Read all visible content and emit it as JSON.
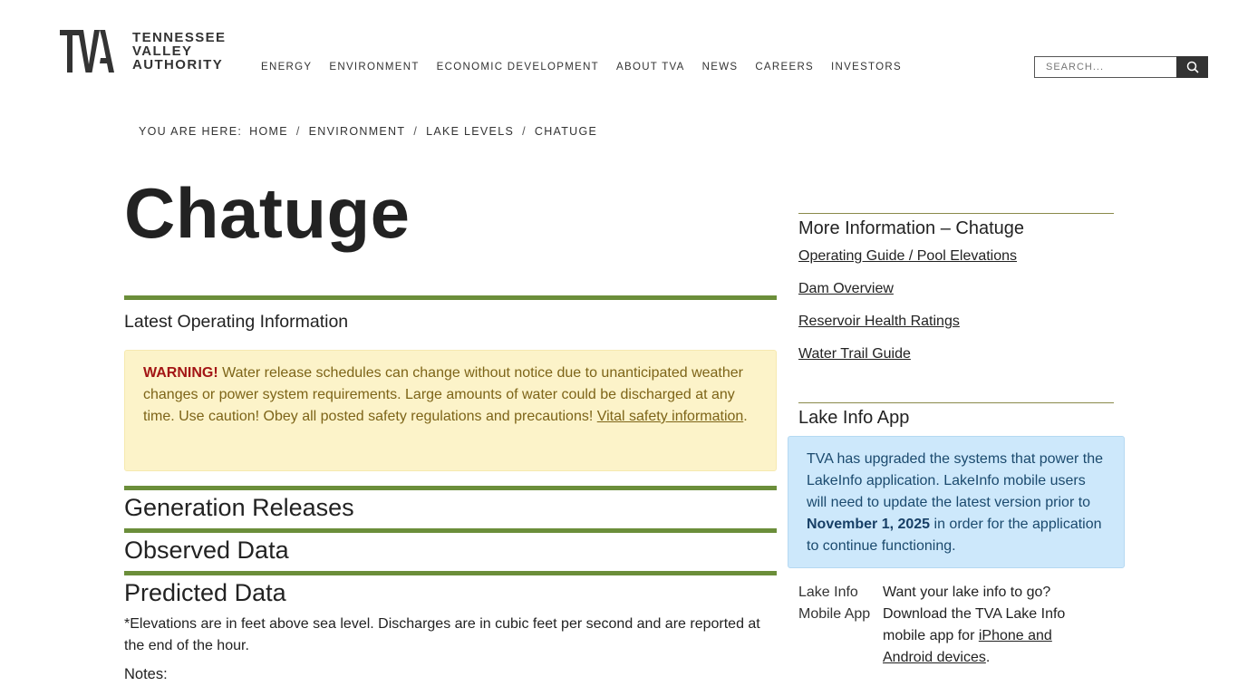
{
  "header": {
    "logo_lines": [
      "TENNESSEE",
      "VALLEY",
      "AUTHORITY"
    ],
    "nav": [
      "ENERGY",
      "ENVIRONMENT",
      "ECONOMIC DEVELOPMENT",
      "ABOUT TVA",
      "NEWS",
      "CAREERS",
      "INVESTORS"
    ],
    "search_placeholder": "SEARCH..."
  },
  "breadcrumb": {
    "lead": "YOU ARE HERE:",
    "items": [
      "HOME",
      "ENVIRONMENT",
      "LAKE LEVELS",
      "CHATUGE"
    ]
  },
  "main": {
    "title": "Chatuge",
    "latest_heading": "Latest Operating Information",
    "warning_label": "WARNING!",
    "warning_text": " Water release schedules can change without notice due to unanticipated weather changes or power system requirements. Large amounts of water could be discharged at any time. Use caution! Obey all posted safety regulations and precautions!",
    "warning_link": "Vital safety information",
    "warning_period": ".",
    "generation_heading": "Generation Releases",
    "observed_heading": "Observed Data",
    "predicted_heading": "Predicted Data",
    "elevations_note": "*Elevations are in feet above sea level. Discharges are in cubic feet per second and are reported at the end of the hour.",
    "notes_label": "Notes:"
  },
  "sidebar": {
    "more_heading": "More Information – Chatuge",
    "links": [
      "Operating Guide / Pool Elevations",
      "Dam Overview",
      "Reservoir Health Ratings",
      "Water Trail Guide"
    ],
    "app_heading": "Lake Info App",
    "info_text_1": "TVA has upgraded the systems that power the LakeInfo application. LakeInfo mobile users will need to update the latest version prior to ",
    "info_date": "November 1, 2025",
    "info_text_2": " in order for the application to continue functioning.",
    "app_img_alt": "Lake Info Mobile App",
    "app_text_1": "Want your lake info to go? Download the TVA Lake Info mobile app for ",
    "app_link": "iPhone and Android devices",
    "app_text_2": "."
  },
  "colors": {
    "accent_green": "#6b8e3a",
    "warning_bg": "#fcf3c9",
    "info_bg": "#cde8fb",
    "warning_red": "#a31515"
  }
}
